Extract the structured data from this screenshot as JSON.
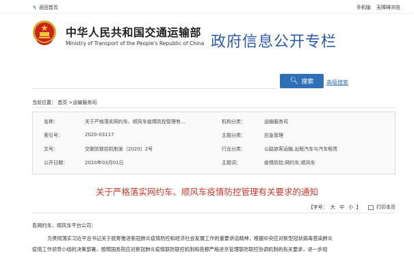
{
  "topbar": {
    "back_label": "返回首页",
    "mobile_label": "手机版",
    "accessible_label": "无障碍浏览"
  },
  "header": {
    "ministry_cn": "中华人民共和国交通运输部",
    "ministry_en": "Ministry of Transport of the People's Republic of China",
    "site_title": "政府信息公开专栏"
  },
  "search": {
    "placeholder": "",
    "button_label": "搜索",
    "advanced_label": "高级搜索"
  },
  "breadcrumb": "当前位置： 首页 >运输服务司",
  "meta": {
    "name_label": "名称：",
    "name_value": "关于严格落实网约车、顺风车疫情防控管理有...",
    "org_label": "机构分类：",
    "org_value": "运输服务司",
    "index_label": "索引号：",
    "index_value": "2020-03117",
    "topic_label": "主题分类：",
    "topic_value": "应急管理",
    "docno_label": "文号：",
    "docno_value": "交联防联控机制发〔2020〕2号",
    "industry_label": "行业分类：",
    "industry_value": "公路旅客运输,出租汽车与汽车租赁",
    "date_label": "公开日期：",
    "date_value": "2020年03月01日",
    "keyword_label": "主题词：",
    "keyword_value": "疫情防控;网约车;顺风车"
  },
  "doc": {
    "title": "关于严格落实网约车、顺风车疫情防控管理有关要求的通知",
    "font_label": "【字号：",
    "size_large": "大",
    "size_medium": "中",
    "size_small": "小",
    "font_close": "】",
    "print_label": "打印本页",
    "para_1": "各网约车、顺风车平台公司：",
    "para_2a": "为贯彻落实习近平总书记关于统筹推进新冠肺炎疫情防控和经济社会发展工作的重要讲话精神，根据中央应对新型冠状病毒感染肺炎",
    "para_2b": "疫情工作领导小组的决策部署，按照国务院应对新冠肺炎疫情联防联控机制和首都严格进京管理联防联控协调机制的有关要求，进一步规"
  }
}
